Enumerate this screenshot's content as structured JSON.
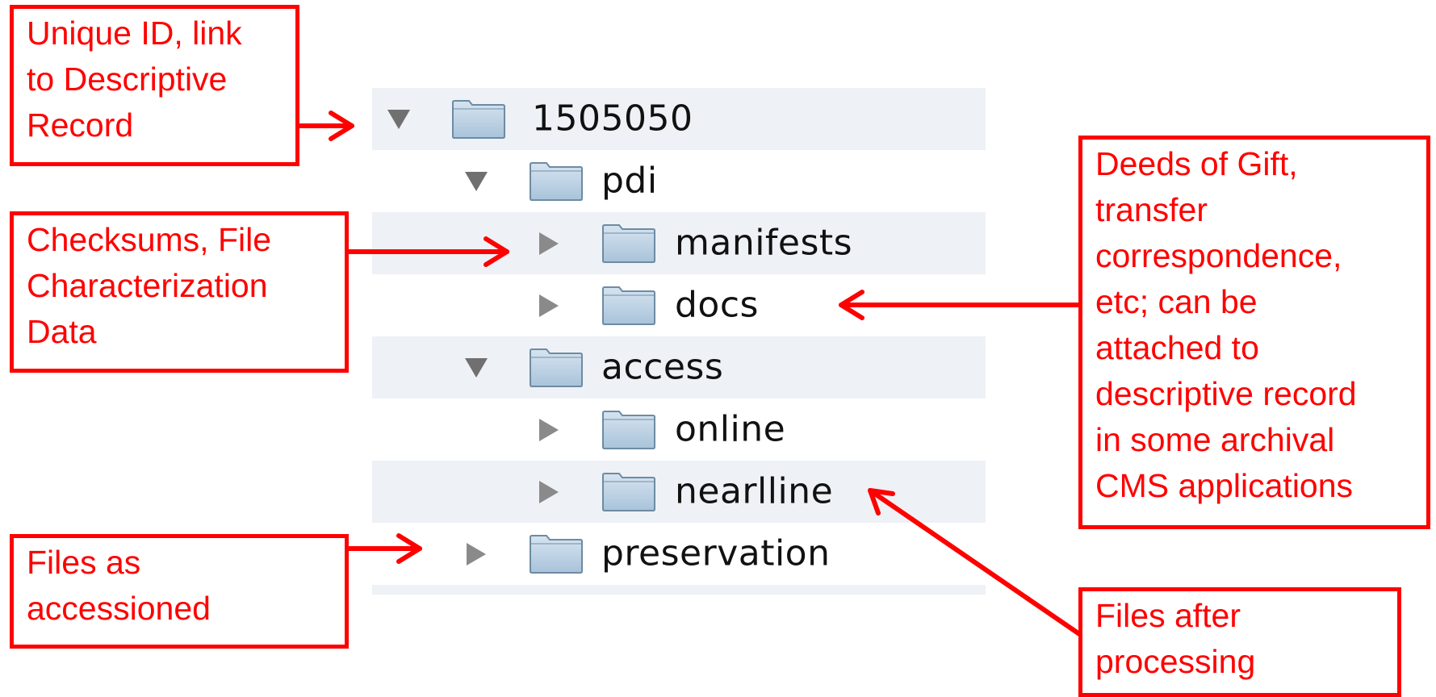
{
  "tree": [
    {
      "name": "1505050",
      "state": "expanded",
      "depth": 0,
      "striped": true
    },
    {
      "name": "pdi",
      "state": "expanded",
      "depth": 1,
      "striped": false
    },
    {
      "name": "manifests",
      "state": "collapsed",
      "depth": 2,
      "striped": true
    },
    {
      "name": "docs",
      "state": "collapsed",
      "depth": 2,
      "striped": false
    },
    {
      "name": "access",
      "state": "expanded",
      "depth": 1,
      "striped": true
    },
    {
      "name": "online",
      "state": "collapsed",
      "depth": 2,
      "striped": false
    },
    {
      "name": "nearlline",
      "state": "collapsed",
      "depth": 2,
      "striped": true
    },
    {
      "name": "preservation",
      "state": "collapsed",
      "depth": 1,
      "striped": false
    }
  ],
  "callouts": {
    "unique_id": [
      "Unique ID, link",
      "to Descriptive",
      "Record"
    ],
    "checksums": [
      "Checksums, File",
      "Characterization",
      "Data"
    ],
    "files_accessioned": [
      "Files as",
      "accessioned"
    ],
    "deeds": [
      "Deeds of Gift,",
      "transfer",
      "correspondence,",
      "etc; can be",
      "attached to",
      "descriptive record",
      "in some archival",
      "CMS applications"
    ],
    "files_after": [
      "Files after",
      "processing"
    ]
  },
  "colors": {
    "callout_red": "#ff0000",
    "row_stripe": "#eef1f5",
    "folder_blue": "#a9c3da"
  },
  "icons": {
    "folder": "folder-icon",
    "expanded": "triangle-down-icon",
    "collapsed": "triangle-right-icon"
  }
}
